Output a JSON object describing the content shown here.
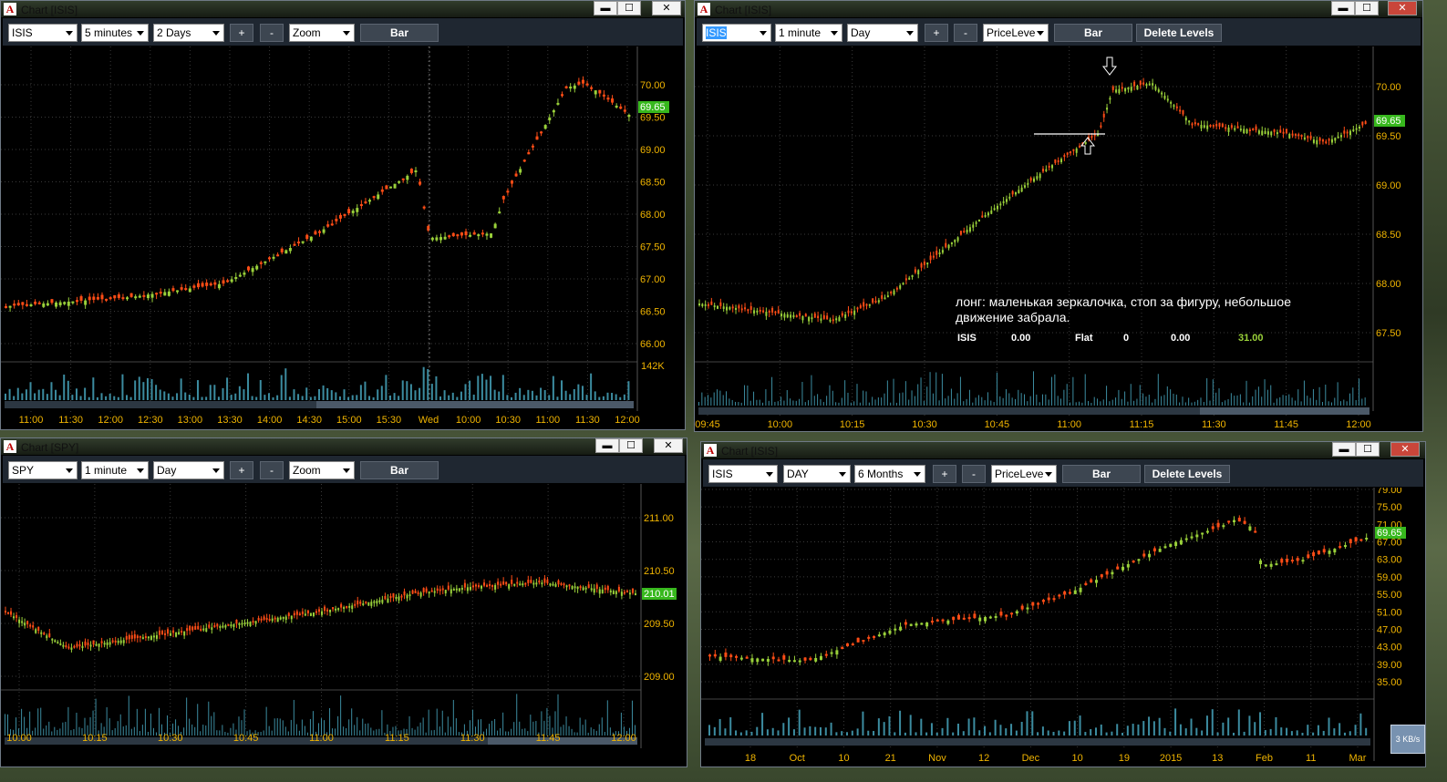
{
  "colors": {
    "up": "#9ad13a",
    "down": "#ff4d16",
    "axis": "#f0b400",
    "grid": "#3a3a3a",
    "volume": "#3c8ca0",
    "price_label_bg": "#37b81d"
  },
  "windows": [
    {
      "id": "w1",
      "title": "Chart [ISIS]",
      "toolbar": {
        "symbol": "ISIS",
        "interval": "5 minutes",
        "range": "2 Days",
        "zoom_in": "+",
        "zoom_out": "-",
        "mode": "Zoom",
        "chart_type": "Bar"
      },
      "current_price": "69.65",
      "volume_label": "142K",
      "price_ticks": [
        "70.00",
        "69.50",
        "69.00",
        "68.50",
        "68.00",
        "67.50",
        "67.00",
        "66.50",
        "66.00"
      ],
      "time_labels": [
        "11:00",
        "11:30",
        "12:00",
        "12:30",
        "13:00",
        "13:30",
        "14:00",
        "14:30",
        "15:00",
        "15:30",
        "Wed",
        "10:00",
        "10:30",
        "11:00",
        "11:30",
        "12:00"
      ]
    },
    {
      "id": "w2",
      "title": "Chart [ISIS]",
      "toolbar": {
        "symbol": "ISIS",
        "interval": "1 minute",
        "range": "Day",
        "zoom_in": "+",
        "zoom_out": "-",
        "mode": "PriceLeve",
        "chart_type": "Bar",
        "delete": "Delete Levels"
      },
      "current_price": "69.65",
      "price_ticks": [
        "70.00",
        "69.50",
        "69.00",
        "68.50",
        "68.00",
        "67.50"
      ],
      "time_labels": [
        "09:45",
        "10:00",
        "10:15",
        "10:30",
        "10:45",
        "11:00",
        "11:15",
        "11:30",
        "11:45",
        "12:00"
      ],
      "annotation": "лонг: маленькая зеркалочка, стоп за фигуру, небольшое движение забрала.",
      "position": [
        "ISIS",
        "0.00",
        "Flat",
        "0",
        "0.00",
        "31.00"
      ]
    },
    {
      "id": "w3",
      "title": "Chart [SPY]",
      "toolbar": {
        "symbol": "SPY",
        "interval": "1 minute",
        "range": "Day",
        "zoom_in": "+",
        "zoom_out": "-",
        "mode": "Zoom",
        "chart_type": "Bar"
      },
      "current_price": "210.01",
      "price_ticks": [
        "211.00",
        "210.50",
        "209.50",
        "209.00"
      ],
      "time_labels": [
        "10:00",
        "10:15",
        "10:30",
        "10:45",
        "11:00",
        "11:15",
        "11:30",
        "11:45",
        "12:00"
      ]
    },
    {
      "id": "w4",
      "title": "Chart [ISIS]",
      "toolbar": {
        "symbol": "ISIS",
        "interval": "DAY",
        "range": "6 Months",
        "zoom_in": "+",
        "zoom_out": "-",
        "mode": "PriceLeve",
        "chart_type": "Bar",
        "delete": "Delete Levels"
      },
      "current_price": "69.65",
      "price_ticks": [
        "79.00",
        "75.00",
        "71.00",
        "67.00",
        "63.00",
        "59.00",
        "55.00",
        "51.00",
        "47.00",
        "43.00",
        "39.00",
        "35.00"
      ],
      "time_labels": [
        "18",
        "Oct",
        "10",
        "21",
        "Nov",
        "12",
        "Dec",
        "10",
        "19",
        "2015",
        "13",
        "Feb",
        "11",
        "Mar"
      ]
    }
  ],
  "window_buttons": {
    "minimize": "▬",
    "maximize": "☐",
    "close": "✕"
  },
  "net_meter": "3 KB/s"
}
